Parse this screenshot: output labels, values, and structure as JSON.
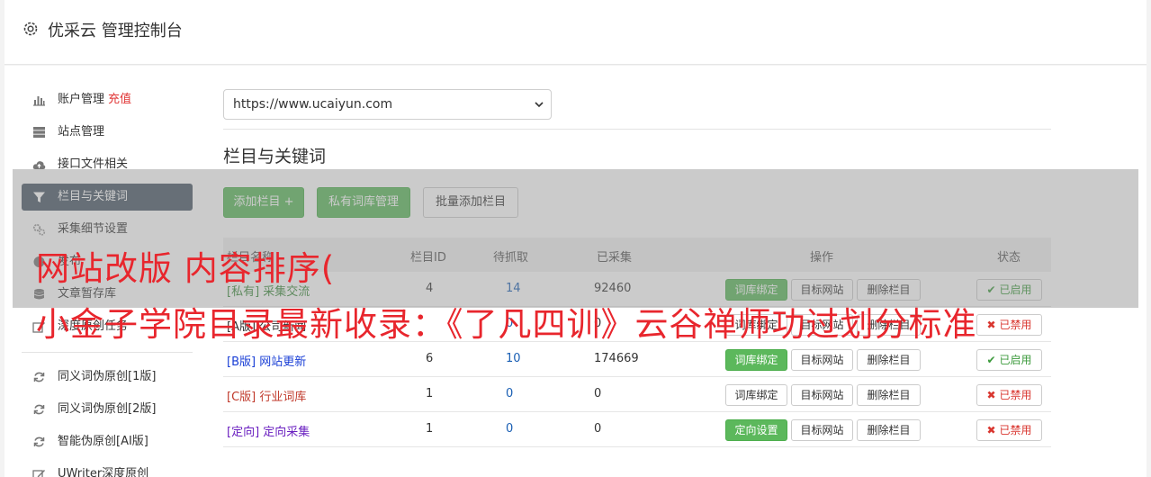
{
  "header": {
    "title": "优采云 管理控制台",
    "icon": "gear-icon"
  },
  "sidebar": {
    "items": [
      {
        "label": "账户管理",
        "extra": "充值",
        "icon": "bar-chart-icon"
      },
      {
        "label": "站点管理",
        "icon": "server-icon"
      },
      {
        "label": "接口文件相关",
        "icon": "cloud-upload-icon"
      },
      {
        "label": "栏目与关键词",
        "icon": "filter-icon",
        "active": true
      },
      {
        "label": "采集细节设置",
        "icon": "cogs-icon"
      },
      {
        "label": "发布 ",
        "icon": "circle-icon"
      },
      {
        "label": "文章暂存库",
        "icon": "database-icon"
      },
      {
        "label": "深度原创任务",
        "icon": "edit-icon"
      }
    ],
    "items2": [
      {
        "label": "同义词伪原创[1版]",
        "icon": "refresh-icon"
      },
      {
        "label": "同义词伪原创[2版]",
        "icon": "refresh-icon"
      },
      {
        "label": "智能伪原创[AI版]",
        "icon": "refresh-icon"
      },
      {
        "label": "UWriter深度原创",
        "icon": "edit-icon"
      }
    ],
    "accent_red": "#e03434"
  },
  "site_select": {
    "value": "https://www.ucaiyun.com"
  },
  "section": {
    "title": "栏目与关键词"
  },
  "toolbar": {
    "add_column": "添加栏目 +",
    "private_lib": "私有词库管理",
    "batch_add": "批量添加栏目"
  },
  "table": {
    "headers": [
      "栏目名称",
      "栏目ID",
      "待抓取",
      "已采集",
      "操作",
      "状态"
    ],
    "rows": [
      {
        "tag": "[私有]",
        "name": "采集交流",
        "tag_color": "#3c8a3c",
        "id": "4",
        "pending": "14",
        "collected": "92460",
        "action1": "词库绑定",
        "action1_green": true,
        "action2": "目标网站",
        "action3": "删除栏目",
        "status": "已启用",
        "enabled": true
      },
      {
        "tag": "[A版]",
        "name": "公司新闻",
        "tag_color": "#333333",
        "id": "",
        "pending": "0",
        "collected": "0",
        "action1": "词库绑定",
        "action1_green": false,
        "action2": "目标网站",
        "action3": "删除栏目",
        "status": "已禁用",
        "enabled": false
      },
      {
        "tag": "[B版]",
        "name": "网站更新",
        "tag_color": "#1a3fd6",
        "id": "6",
        "pending": "10",
        "collected": "174669",
        "action1": "词库绑定",
        "action1_green": true,
        "action2": "目标网站",
        "action3": "删除栏目",
        "status": "已启用",
        "enabled": true
      },
      {
        "tag": "[C版]",
        "name": "行业词库",
        "tag_color": "#c0392b",
        "id": "1",
        "pending": "0",
        "collected": "0",
        "action1": "词库绑定",
        "action1_green": false,
        "action2": "目标网站",
        "action3": "删除栏目",
        "status": "已禁用",
        "enabled": false
      },
      {
        "tag": "[定向]",
        "name": "定向采集",
        "tag_color": "#6a1fc0",
        "id": "1",
        "pending": "0",
        "collected": "0",
        "action1": "定向设置",
        "action1_green": true,
        "action2": "目标网站",
        "action3": "删除栏目",
        "status": "已禁用",
        "enabled": false
      }
    ],
    "link_blue": "#1a5fb4"
  },
  "watermark": {
    "line1": "网站改版 内容排序(",
    "line2": "小金子学院目录最新收录：《了凡四训》云谷禅师功过划分标准"
  }
}
